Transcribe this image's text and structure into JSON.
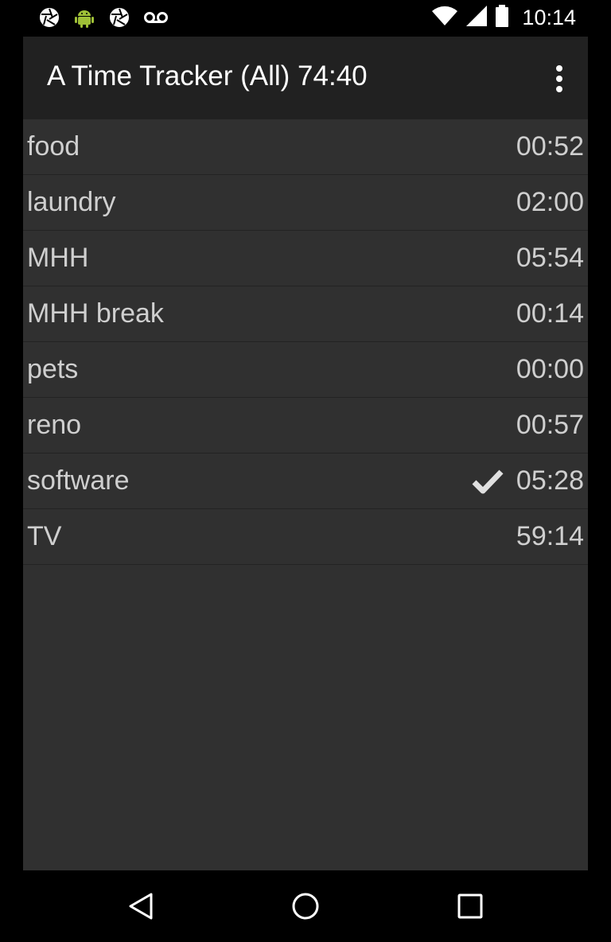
{
  "status_bar": {
    "left_icons": [
      "aperture-icon",
      "android-icon",
      "aperture-icon",
      "voicemail-icon"
    ],
    "right_icons": [
      "wifi-icon",
      "signal-icon",
      "battery-icon"
    ],
    "time": "10:14"
  },
  "action_bar": {
    "title": "A Time Tracker (All) 74:40",
    "menu_icon": "overflow-menu-icon"
  },
  "tasks": [
    {
      "name": "food",
      "time": "00:52",
      "active": false
    },
    {
      "name": "laundry",
      "time": "02:00",
      "active": false
    },
    {
      "name": "MHH",
      "time": "05:54",
      "active": false
    },
    {
      "name": "MHH break",
      "time": "00:14",
      "active": false
    },
    {
      "name": "pets",
      "time": "00:00",
      "active": false
    },
    {
      "name": "reno",
      "time": "00:57",
      "active": false
    },
    {
      "name": "software",
      "time": "05:28",
      "active": true
    },
    {
      "name": "TV",
      "time": "59:14",
      "active": false
    }
  ],
  "nav_bar": {
    "buttons": [
      "back-icon",
      "home-icon",
      "recents-icon"
    ]
  },
  "colors": {
    "action_bar_bg": "#212121",
    "list_bg": "#303030",
    "text": "#cfcfcf"
  }
}
